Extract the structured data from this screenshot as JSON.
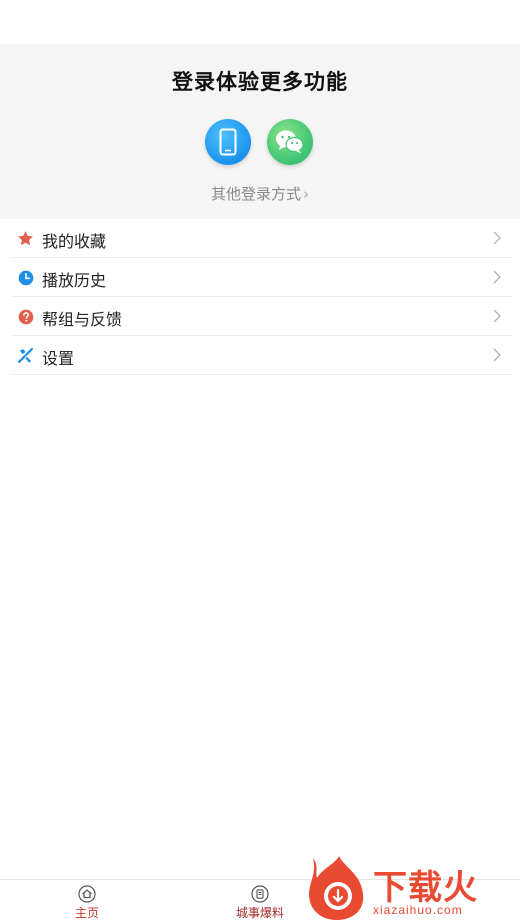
{
  "login": {
    "title": "登录体验更多功能",
    "phone_icon": "smartphone-icon",
    "wechat_icon": "wechat-icon",
    "other_login_label": "其他登录方式",
    "phone_color": "#1b93ec",
    "wechat_color": "#45c777"
  },
  "menu": {
    "items": [
      {
        "label": "我的收藏",
        "icon": "star-icon",
        "icon_color": "#e0604b"
      },
      {
        "label": "播放历史",
        "icon": "clock-icon",
        "icon_color": "#1e8fe8"
      },
      {
        "label": "帮组与反馈",
        "icon": "help-icon",
        "icon_color": "#e0604b"
      },
      {
        "label": "设置",
        "icon": "tools-icon",
        "icon_color": "#1e8fe8"
      }
    ]
  },
  "tabs": [
    {
      "label": "主页",
      "icon": "home-icon"
    },
    {
      "label": "城事爆料",
      "icon": "report-icon"
    }
  ],
  "watermark": {
    "title": "下载火",
    "subtitle": "xiazaihuo.com",
    "color": "#e84a32"
  }
}
